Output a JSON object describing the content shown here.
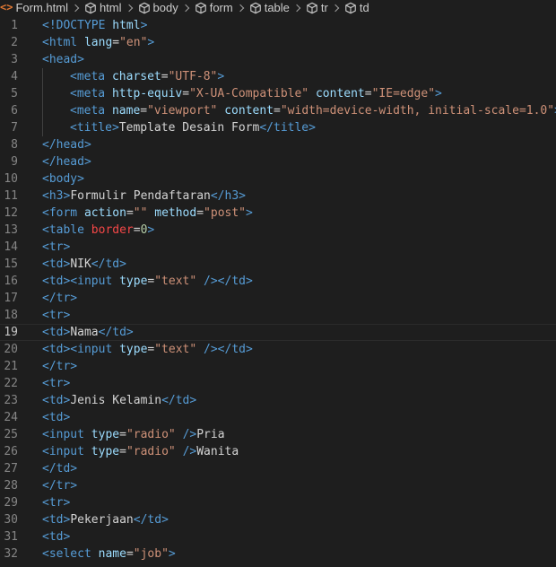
{
  "breadcrumb": {
    "file": "Form.html",
    "items": [
      "html",
      "body",
      "form",
      "table",
      "tr",
      "td"
    ]
  },
  "icons": {
    "file": "html-file-icon",
    "element": "cube-icon"
  },
  "colors": {
    "background": "#1e1e1e",
    "tag": "#569cd6",
    "attribute": "#9cdcfe",
    "string": "#ce9178",
    "text": "#d4d4d4",
    "line_number": "#858585",
    "file_icon": "#e37933"
  },
  "editor": {
    "active_line": 19,
    "lines": [
      {
        "n": "1",
        "indent": 0,
        "tokens": [
          [
            "tag",
            "<!DOCTYPE "
          ],
          [
            "attr",
            "html"
          ],
          [
            "tag",
            ">"
          ]
        ]
      },
      {
        "n": "2",
        "indent": 0,
        "tokens": [
          [
            "tag",
            "<html "
          ],
          [
            "attr",
            "lang"
          ],
          [
            "text",
            "="
          ],
          [
            "str",
            "\"en\""
          ],
          [
            "tag",
            ">"
          ]
        ]
      },
      {
        "n": "3",
        "indent": 0,
        "tokens": [
          [
            "tag",
            "<head>"
          ]
        ]
      },
      {
        "n": "4",
        "indent": 1,
        "tokens": [
          [
            "tag",
            "<meta "
          ],
          [
            "attr",
            "charset"
          ],
          [
            "text",
            "="
          ],
          [
            "str",
            "\"UTF-8\""
          ],
          [
            "tag",
            ">"
          ]
        ]
      },
      {
        "n": "5",
        "indent": 1,
        "tokens": [
          [
            "tag",
            "<meta "
          ],
          [
            "attr",
            "http-equiv"
          ],
          [
            "text",
            "="
          ],
          [
            "str",
            "\"X-UA-Compatible\""
          ],
          [
            "text",
            " "
          ],
          [
            "attr",
            "content"
          ],
          [
            "text",
            "="
          ],
          [
            "str",
            "\"IE=edge\""
          ],
          [
            "tag",
            ">"
          ]
        ]
      },
      {
        "n": "6",
        "indent": 1,
        "tokens": [
          [
            "tag",
            "<meta "
          ],
          [
            "attr",
            "name"
          ],
          [
            "text",
            "="
          ],
          [
            "str",
            "\"viewport\""
          ],
          [
            "text",
            " "
          ],
          [
            "attr",
            "content"
          ],
          [
            "text",
            "="
          ],
          [
            "str",
            "\"width=device-width, initial-scale=1.0\""
          ],
          [
            "tag",
            ">"
          ]
        ]
      },
      {
        "n": "7",
        "indent": 1,
        "tokens": [
          [
            "tag",
            "<title>"
          ],
          [
            "text",
            "Template Desain Form"
          ],
          [
            "tag",
            "</title>"
          ]
        ]
      },
      {
        "n": "8",
        "indent": 0,
        "tokens": [
          [
            "tag",
            "</head>"
          ]
        ]
      },
      {
        "n": "9",
        "indent": 0,
        "tokens": [
          [
            "tag",
            "</head>"
          ]
        ]
      },
      {
        "n": "10",
        "indent": 0,
        "tokens": [
          [
            "tag",
            "<body>"
          ]
        ]
      },
      {
        "n": "11",
        "indent": 0,
        "tokens": [
          [
            "tag",
            "<h3>"
          ],
          [
            "text",
            "Formulir Pendaftaran"
          ],
          [
            "tag",
            "</h3>"
          ]
        ]
      },
      {
        "n": "12",
        "indent": 0,
        "tokens": [
          [
            "tag",
            "<form "
          ],
          [
            "attr",
            "action"
          ],
          [
            "text",
            "="
          ],
          [
            "str",
            "\"\""
          ],
          [
            "text",
            " "
          ],
          [
            "attr",
            "method"
          ],
          [
            "text",
            "="
          ],
          [
            "str",
            "\"post\""
          ],
          [
            "tag",
            ">"
          ]
        ]
      },
      {
        "n": "13",
        "indent": 0,
        "tokens": [
          [
            "tag",
            "<table "
          ],
          [
            "red",
            "border"
          ],
          [
            "text",
            "="
          ],
          [
            "num",
            "0"
          ],
          [
            "tag",
            ">"
          ]
        ]
      },
      {
        "n": "14",
        "indent": 0,
        "tokens": [
          [
            "tag",
            "<tr>"
          ]
        ]
      },
      {
        "n": "15",
        "indent": 0,
        "tokens": [
          [
            "tag",
            "<td>"
          ],
          [
            "text",
            "NIK"
          ],
          [
            "tag",
            "</td>"
          ]
        ]
      },
      {
        "n": "16",
        "indent": 0,
        "tokens": [
          [
            "tag",
            "<td><input "
          ],
          [
            "attr",
            "type"
          ],
          [
            "text",
            "="
          ],
          [
            "str",
            "\"text\""
          ],
          [
            "text",
            " "
          ],
          [
            "tag",
            "/></td>"
          ]
        ]
      },
      {
        "n": "17",
        "indent": 0,
        "tokens": [
          [
            "tag",
            "</tr>"
          ]
        ]
      },
      {
        "n": "18",
        "indent": 0,
        "tokens": [
          [
            "tag",
            "<tr>"
          ]
        ]
      },
      {
        "n": "19",
        "indent": 0,
        "tokens": [
          [
            "tag",
            "<td>"
          ],
          [
            "text",
            "Nama"
          ],
          [
            "tag",
            "</td>"
          ]
        ]
      },
      {
        "n": "20",
        "indent": 0,
        "tokens": [
          [
            "tag",
            "<td><input "
          ],
          [
            "attr",
            "type"
          ],
          [
            "text",
            "="
          ],
          [
            "str",
            "\"text\""
          ],
          [
            "text",
            " "
          ],
          [
            "tag",
            "/></td>"
          ]
        ]
      },
      {
        "n": "21",
        "indent": 0,
        "tokens": [
          [
            "tag",
            "</tr>"
          ]
        ]
      },
      {
        "n": "22",
        "indent": 0,
        "tokens": [
          [
            "tag",
            "<tr>"
          ]
        ]
      },
      {
        "n": "23",
        "indent": 0,
        "tokens": [
          [
            "tag",
            "<td>"
          ],
          [
            "text",
            "Jenis Kelamin"
          ],
          [
            "tag",
            "</td>"
          ]
        ]
      },
      {
        "n": "24",
        "indent": 0,
        "tokens": [
          [
            "tag",
            "<td>"
          ]
        ]
      },
      {
        "n": "25",
        "indent": 0,
        "tokens": [
          [
            "tag",
            "<input "
          ],
          [
            "attr",
            "type"
          ],
          [
            "text",
            "="
          ],
          [
            "str",
            "\"radio\""
          ],
          [
            "text",
            " "
          ],
          [
            "tag",
            "/>"
          ],
          [
            "text",
            "Pria"
          ]
        ]
      },
      {
        "n": "26",
        "indent": 0,
        "tokens": [
          [
            "tag",
            "<input "
          ],
          [
            "attr",
            "type"
          ],
          [
            "text",
            "="
          ],
          [
            "str",
            "\"radio\""
          ],
          [
            "text",
            " "
          ],
          [
            "tag",
            "/>"
          ],
          [
            "text",
            "Wanita"
          ]
        ]
      },
      {
        "n": "27",
        "indent": 0,
        "tokens": [
          [
            "tag",
            "</td>"
          ]
        ]
      },
      {
        "n": "28",
        "indent": 0,
        "tokens": [
          [
            "tag",
            "</tr>"
          ]
        ]
      },
      {
        "n": "29",
        "indent": 0,
        "tokens": [
          [
            "tag",
            "<tr>"
          ]
        ]
      },
      {
        "n": "30",
        "indent": 0,
        "tokens": [
          [
            "tag",
            "<td>"
          ],
          [
            "text",
            "Pekerjaan"
          ],
          [
            "tag",
            "</td>"
          ]
        ]
      },
      {
        "n": "31",
        "indent": 0,
        "tokens": [
          [
            "tag",
            "<td>"
          ]
        ]
      },
      {
        "n": "32",
        "indent": 0,
        "tokens": [
          [
            "tag",
            "<select "
          ],
          [
            "attr",
            "name"
          ],
          [
            "text",
            "="
          ],
          [
            "str",
            "\"job\""
          ],
          [
            "tag",
            ">"
          ]
        ]
      }
    ]
  }
}
